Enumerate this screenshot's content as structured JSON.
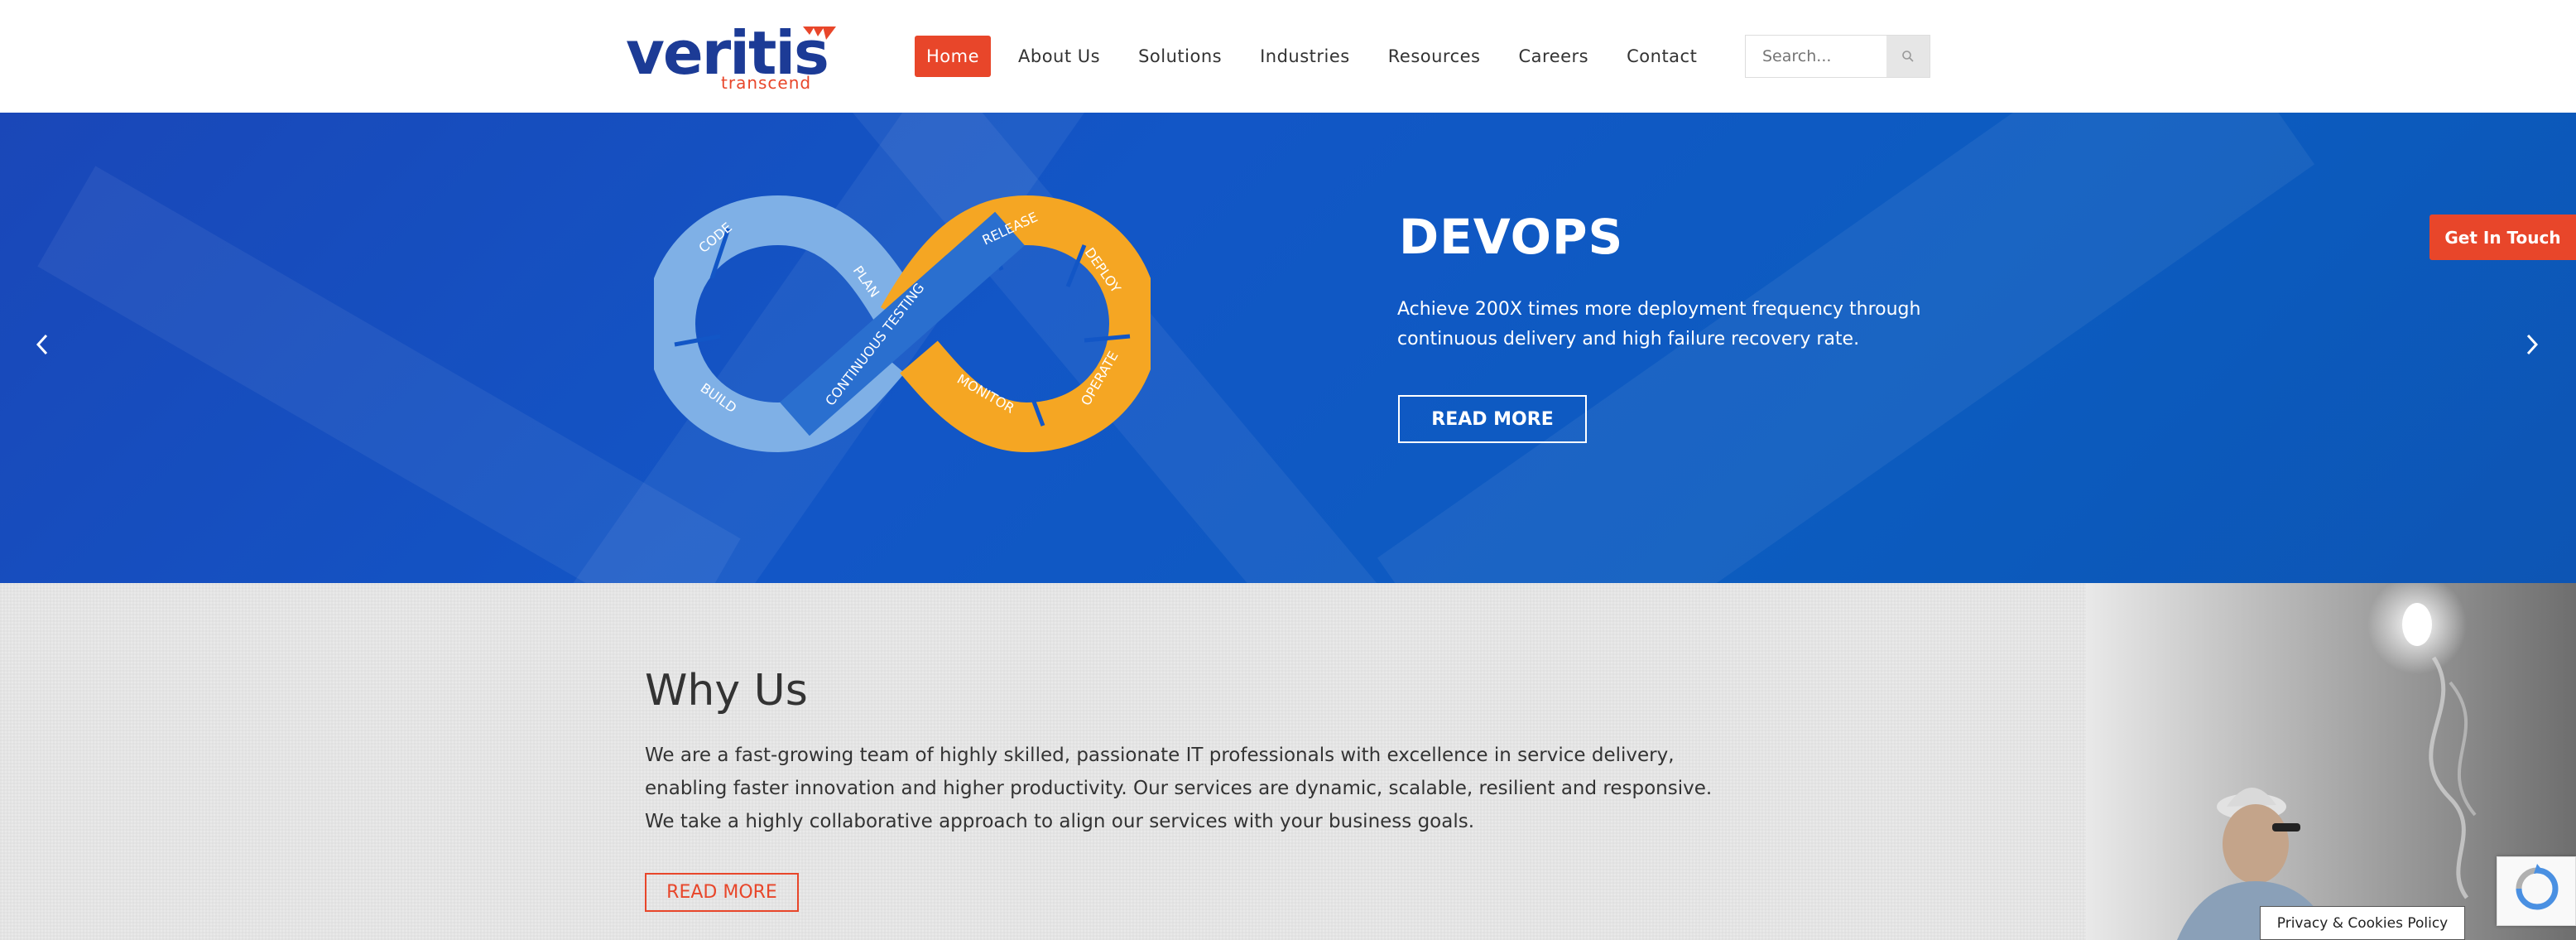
{
  "header": {
    "logo_text": "veritis",
    "logo_tagline": "transcend",
    "nav": [
      {
        "label": "Home",
        "active": true
      },
      {
        "label": "About Us"
      },
      {
        "label": "Solutions"
      },
      {
        "label": "Industries"
      },
      {
        "label": "Resources"
      },
      {
        "label": "Careers"
      },
      {
        "label": "Contact"
      }
    ],
    "search_placeholder": "Search..."
  },
  "hero": {
    "title": "DEVOPS",
    "text": "Achieve 200X times more deployment frequency through continuous delivery and high failure recovery rate.",
    "button": "READ MORE",
    "diagram_labels": {
      "code": "CODE",
      "build": "BUILD",
      "plan": "PLAN",
      "continuous_testing": "CONTINUOUS TESTING",
      "release": "RELEASE",
      "deploy": "DEPLOY",
      "operate": "OPERATE",
      "monitor": "MONITOR"
    }
  },
  "get_in_touch": "Get In Touch",
  "why_us": {
    "title": "Why Us",
    "text": "We are a fast-growing team of highly skilled, passionate IT professionals with excellence in service delivery, enabling faster innovation and higher productivity. Our services are dynamic, scalable, resilient and responsive. We take a highly collaborative approach to align our services with your business goals.",
    "button": "READ MORE"
  },
  "privacy": "Privacy & Cookies Policy",
  "colors": {
    "accent": "#e8462a",
    "brand_blue": "#1c3b96",
    "hero_blue": "#1256c6",
    "devops_light_blue": "#7fb0e6",
    "devops_orange": "#f5a623"
  }
}
